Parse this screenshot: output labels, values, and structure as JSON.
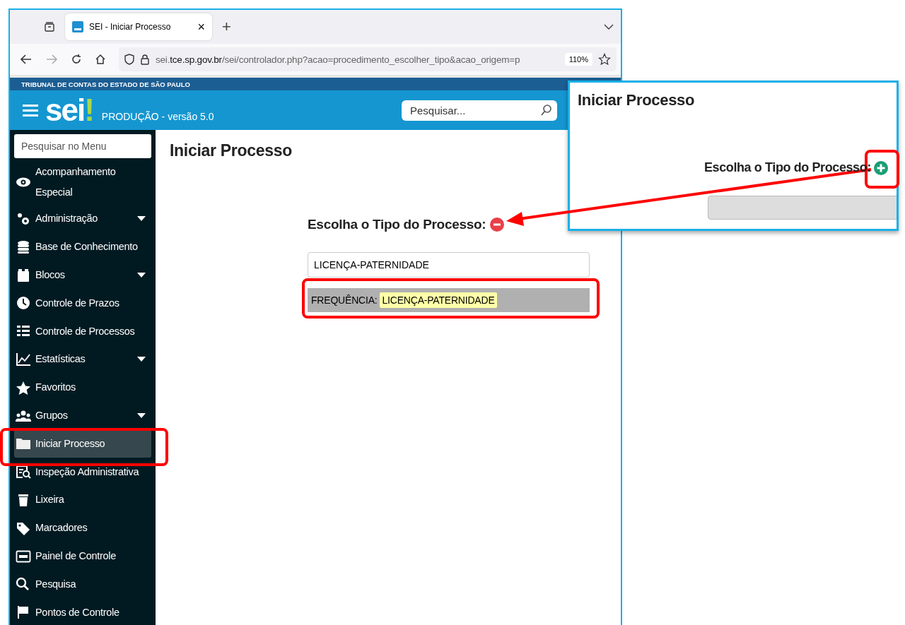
{
  "browser": {
    "tab": {
      "title": "SEI - Iniciar Processo",
      "close": "×"
    },
    "new_tab": "+",
    "url": {
      "prefix": "sei.",
      "domain": "tce.sp.gov.br",
      "path": "/sei/controlador.php?acao=procedimento_escolher_tipo&acao_origem=p"
    },
    "zoom": "110%"
  },
  "site": {
    "org": "TRIBUNAL DE CONTAS DO ESTADO DE SÃO PAULO",
    "logo": {
      "text": "sei",
      "mark": "!"
    },
    "env": "PRODUÇÃO - versão 5.0",
    "search": {
      "placeholder": "Pesquisar..."
    }
  },
  "sidebar": {
    "search": {
      "placeholder": "Pesquisar no Menu"
    },
    "items": [
      {
        "label": "Acompanhamento Especial",
        "expandable": false,
        "selected": false
      },
      {
        "label": "Administração",
        "expandable": true,
        "selected": false
      },
      {
        "label": "Base de Conhecimento",
        "expandable": false,
        "selected": false
      },
      {
        "label": "Blocos",
        "expandable": true,
        "selected": false
      },
      {
        "label": "Controle de Prazos",
        "expandable": false,
        "selected": false
      },
      {
        "label": "Controle de Processos",
        "expandable": false,
        "selected": false
      },
      {
        "label": "Estatísticas",
        "expandable": true,
        "selected": false
      },
      {
        "label": "Favoritos",
        "expandable": false,
        "selected": false
      },
      {
        "label": "Grupos",
        "expandable": true,
        "selected": false
      },
      {
        "label": "Iniciar Processo",
        "expandable": false,
        "selected": true
      },
      {
        "label": "Inspeção Administrativa",
        "expandable": false,
        "selected": false
      },
      {
        "label": "Lixeira",
        "expandable": false,
        "selected": false
      },
      {
        "label": "Marcadores",
        "expandable": false,
        "selected": false
      },
      {
        "label": "Painel de Controle",
        "expandable": false,
        "selected": false
      },
      {
        "label": "Pesquisa",
        "expandable": false,
        "selected": false
      },
      {
        "label": "Pontos de Controle",
        "expandable": false,
        "selected": false
      }
    ]
  },
  "main": {
    "title": "Iniciar Processo",
    "chooser": {
      "label": "Escolha o Tipo do Processo:",
      "expanded": true,
      "filter": "LICENÇA-PATERNIDADE",
      "results": [
        {
          "prefix": "FREQUÊNCIA:",
          "match": "LICENÇA-PATERNIDADE"
        }
      ]
    }
  },
  "inset": {
    "title": "Iniciar Processo",
    "chooser": {
      "label": "Escolha o Tipo do Processo:",
      "expanded": false
    }
  }
}
